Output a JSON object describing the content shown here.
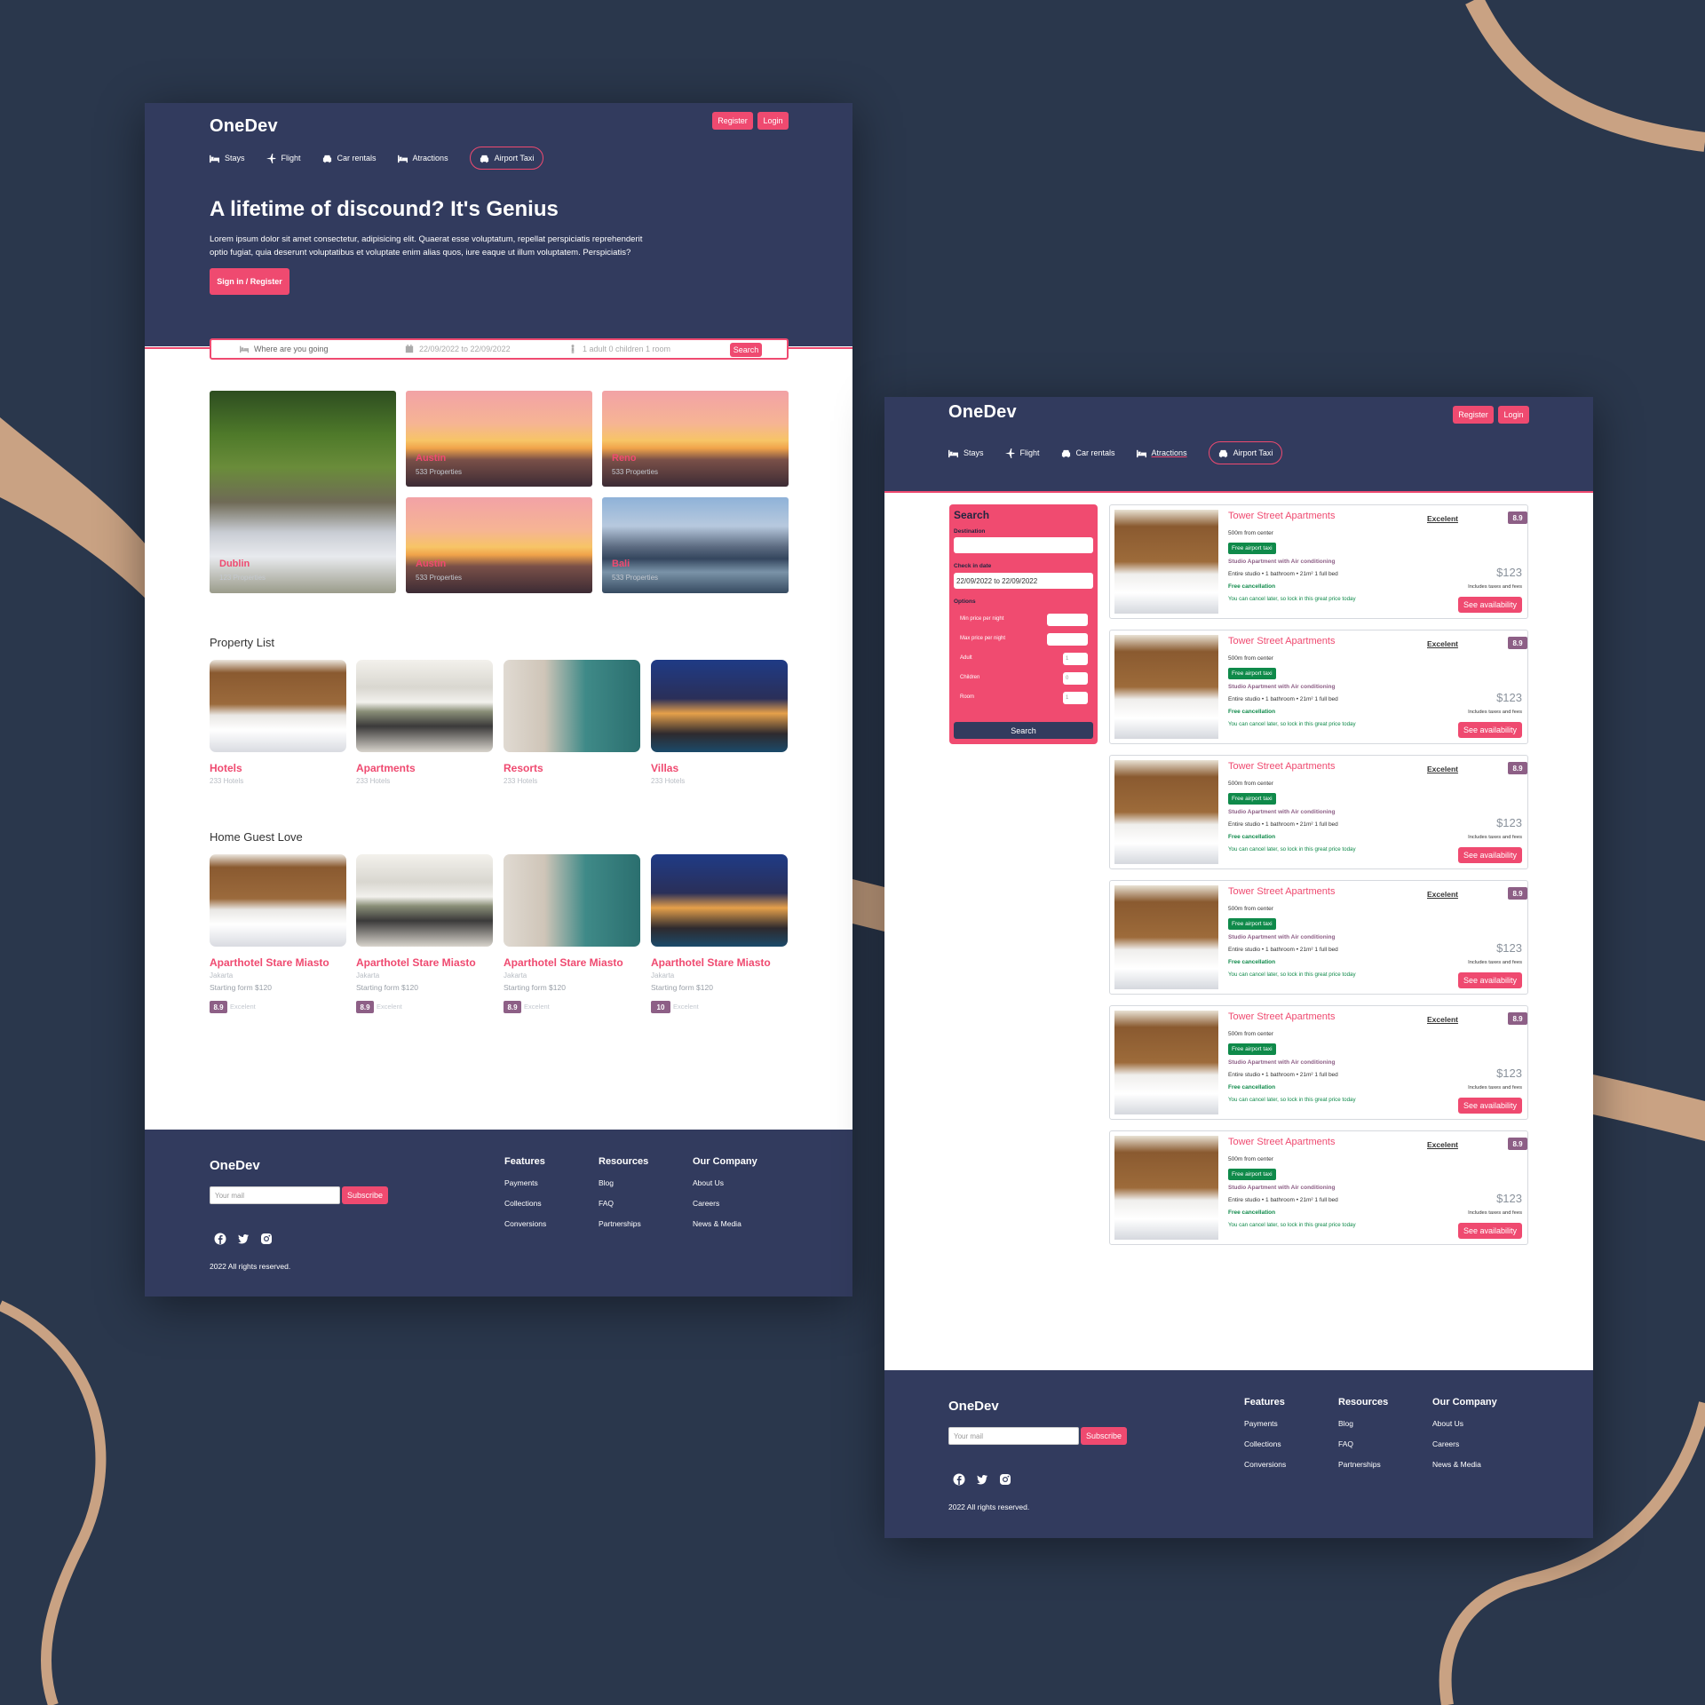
{
  "colors": {
    "background": "#2a374c",
    "navy": "#323b5e",
    "accent": "#ef4a70",
    "rating": "#8d5f86",
    "green": "#0f8a4a",
    "decoration": "#c9a283"
  },
  "home": {
    "brand": "OneDev",
    "register": "Register",
    "login": "Login",
    "nav": [
      {
        "label": "Stays",
        "icon": "bed-icon"
      },
      {
        "label": "Flight",
        "icon": "plane-icon"
      },
      {
        "label": "Car rentals",
        "icon": "car-icon"
      },
      {
        "label": "Atractions",
        "icon": "bed-icon"
      },
      {
        "label": "Airport Taxi",
        "icon": "taxi-icon",
        "active": true
      }
    ],
    "hero": {
      "title": "A lifetime of discound? It's Genius",
      "desc_1": "Lorem ipsum dolor sit amet consectetur, adipisicing elit. Quaerat esse voluptatum, repellat perspiciatis reprehenderit",
      "desc_2": "optio fugiat, quia deserunt voluptatibus et voluptate enim alias quos, iure eaque ut illum voluptatem. Perspiciatis?",
      "cta": "Sign in / Register"
    },
    "search": {
      "destination": "Where are you going",
      "dates": "22/09/2022 to 22/09/2022",
      "guests": "1 adult 0 children 1 room",
      "button": "Search"
    },
    "featured": [
      {
        "title": "Dublin",
        "sub": "123 Properties"
      },
      {
        "title": "Austin",
        "sub": "533 Properties"
      },
      {
        "title": "Reno",
        "sub": "533 Properties"
      },
      {
        "title": "Austin",
        "sub": "533 Properties"
      },
      {
        "title": "Bali",
        "sub": "533 Properties"
      }
    ],
    "property_title": "Property List",
    "property": [
      {
        "title": "Hotels",
        "sub": "233 Hotels"
      },
      {
        "title": "Apartments",
        "sub": "233 Hotels"
      },
      {
        "title": "Resorts",
        "sub": "233 Hotels"
      },
      {
        "title": "Villas",
        "sub": "233 Hotels"
      }
    ],
    "guest_title": "Home Guest Love",
    "guest": [
      {
        "title": "Aparthotel Stare Miasto",
        "city": "Jakarta",
        "price": "Starting form $120",
        "rating": "8.9",
        "label": "Excelent"
      },
      {
        "title": "Aparthotel Stare Miasto",
        "city": "Jakarta",
        "price": "Starting form $120",
        "rating": "8.9",
        "label": "Excelent"
      },
      {
        "title": "Aparthotel Stare Miasto",
        "city": "Jakarta",
        "price": "Starting form $120",
        "rating": "8.9",
        "label": "Excelent"
      },
      {
        "title": "Aparthotel Stare Miasto",
        "city": "Jakarta",
        "price": "Starting form $120",
        "rating": "10",
        "label": "Excelent"
      }
    ]
  },
  "footer": {
    "brand": "OneDev",
    "mail_placeholder": "Your mail",
    "subscribe": "Subscribe",
    "copyright": "2022 All rights reserved.",
    "features": {
      "title": "Features",
      "links": [
        "Payments",
        "Collections",
        "Conversions"
      ]
    },
    "resources": {
      "title": "Resources",
      "links": [
        "Blog",
        "FAQ",
        "Partnerships"
      ]
    },
    "company": {
      "title": "Our Company",
      "links": [
        "About Us",
        "Careers",
        "News & Media"
      ]
    },
    "social": [
      "facebook-icon",
      "twitter-icon",
      "instagram-icon"
    ]
  },
  "list": {
    "brand": "OneDev",
    "register": "Register",
    "login": "Login",
    "nav": [
      {
        "label": "Stays"
      },
      {
        "label": "Flight"
      },
      {
        "label": "Car rentals"
      },
      {
        "label": "Atractions"
      },
      {
        "label": "Airport Taxi",
        "active": true
      }
    ],
    "sidebar": {
      "title": "Search",
      "destination_label": "Destination",
      "checkin_label": "Check in date",
      "checkin_value": "22/09/2022 to 22/09/2022",
      "options_label": "Options",
      "min_label": "Min price per night",
      "max_label": "Max price per night",
      "adult_label": "Adult",
      "adult_value": "1",
      "children_label": "Children",
      "children_value": "0",
      "room_label": "Room",
      "room_value": "1",
      "button": "Search"
    },
    "results": [
      {
        "title": "Tower Street Apartments",
        "dist": "500m from center",
        "badge": "Free airport taxi",
        "feat": "Studio Apartment with Air conditioning",
        "detail": "Entire studio • 1 bathroom • 21m² 1 full bed",
        "cancel": "Free cancellation",
        "note": "You can cancel later, so lock in this great price today",
        "label": "Excelent",
        "rating": "8.9",
        "price": "$123",
        "tax": "Includes taxes and fees",
        "button": "See availability"
      },
      {
        "title": "Tower Street Apartments",
        "dist": "500m from center",
        "badge": "Free airport taxi",
        "feat": "Studio Apartment with Air conditioning",
        "detail": "Entire studio • 1 bathroom • 21m² 1 full bed",
        "cancel": "Free cancellation",
        "note": "You can cancel later, so lock in this great price today",
        "label": "Excelent",
        "rating": "8.9",
        "price": "$123",
        "tax": "Includes taxes and fees",
        "button": "See availability"
      },
      {
        "title": "Tower Street Apartments",
        "dist": "500m from center",
        "badge": "Free airport taxi",
        "feat": "Studio Apartment with Air conditioning",
        "detail": "Entire studio • 1 bathroom • 21m² 1 full bed",
        "cancel": "Free cancellation",
        "note": "You can cancel later, so lock in this great price today",
        "label": "Excelent",
        "rating": "8.9",
        "price": "$123",
        "tax": "Includes taxes and fees",
        "button": "See availability"
      },
      {
        "title": "Tower Street Apartments",
        "dist": "500m from center",
        "badge": "Free airport taxi",
        "feat": "Studio Apartment with Air conditioning",
        "detail": "Entire studio • 1 bathroom • 21m² 1 full bed",
        "cancel": "Free cancellation",
        "note": "You can cancel later, so lock in this great price today",
        "label": "Excelent",
        "rating": "8.9",
        "price": "$123",
        "tax": "Includes taxes and fees",
        "button": "See availability"
      },
      {
        "title": "Tower Street Apartments",
        "dist": "500m from center",
        "badge": "Free airport taxi",
        "feat": "Studio Apartment with Air conditioning",
        "detail": "Entire studio • 1 bathroom • 21m² 1 full bed",
        "cancel": "Free cancellation",
        "note": "You can cancel later, so lock in this great price today",
        "label": "Excelent",
        "rating": "8.9",
        "price": "$123",
        "tax": "Includes taxes and fees",
        "button": "See availability"
      },
      {
        "title": "Tower Street Apartments",
        "dist": "500m from center",
        "badge": "Free airport taxi",
        "feat": "Studio Apartment with Air conditioning",
        "detail": "Entire studio • 1 bathroom • 21m² 1 full bed",
        "cancel": "Free cancellation",
        "note": "You can cancel later, so lock in this great price today",
        "label": "Excelent",
        "rating": "8.9",
        "price": "$123",
        "tax": "Includes taxes and fees",
        "button": "See availability"
      }
    ]
  }
}
